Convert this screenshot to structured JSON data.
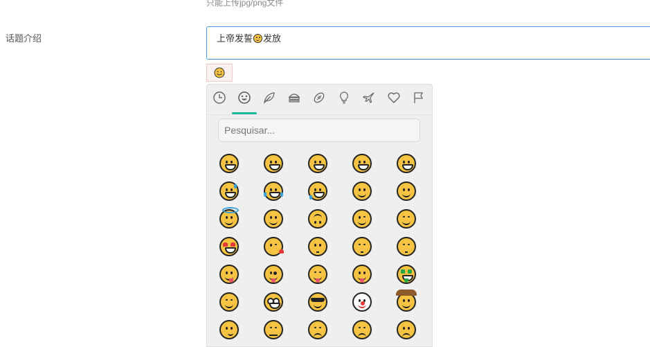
{
  "form": {
    "upload_hint": "只能上传jpg/png文件",
    "topic_intro_label": "话题介绍",
    "topic_intro_before": "上帝发誓",
    "topic_intro_after": "发放"
  },
  "picker": {
    "search_placeholder": "Pesquisar...",
    "accent_color": "#20b89b",
    "categories": [
      "recent-icon",
      "smileys-icon",
      "nature-icon",
      "food-icon",
      "activity-icon",
      "objects-icon",
      "travel-icon",
      "symbols-icon",
      "flags-icon"
    ],
    "active_category": "smileys-icon",
    "emojis": [
      [
        "grinning-face",
        "smiley-face",
        "smile-face",
        "beaming-face",
        "squinting-face"
      ],
      [
        "sweat-smile-face",
        "tears-of-joy-face",
        "rofl-face",
        "relieved-face",
        "smiling-eyes-face"
      ],
      [
        "halo-face",
        "slight-smile-face",
        "upside-down-face",
        "wink-face",
        "blush-face"
      ],
      [
        "heart-eyes-face",
        "kissing-heart-face",
        "kissing-face",
        "kissing-smiling-eyes-face",
        "kissing-closed-eyes-face"
      ],
      [
        "yum-face",
        "winking-tongue-face",
        "squinting-tongue-face",
        "tongue-face",
        "money-mouth-face"
      ],
      [
        "hugging-face",
        "nerd-face",
        "sunglasses-face",
        "clown-face",
        "cowboy-face"
      ],
      [
        "smirk-face",
        "unamused-face",
        "disappointed-face",
        "pensive-face",
        "worried-face"
      ]
    ]
  }
}
